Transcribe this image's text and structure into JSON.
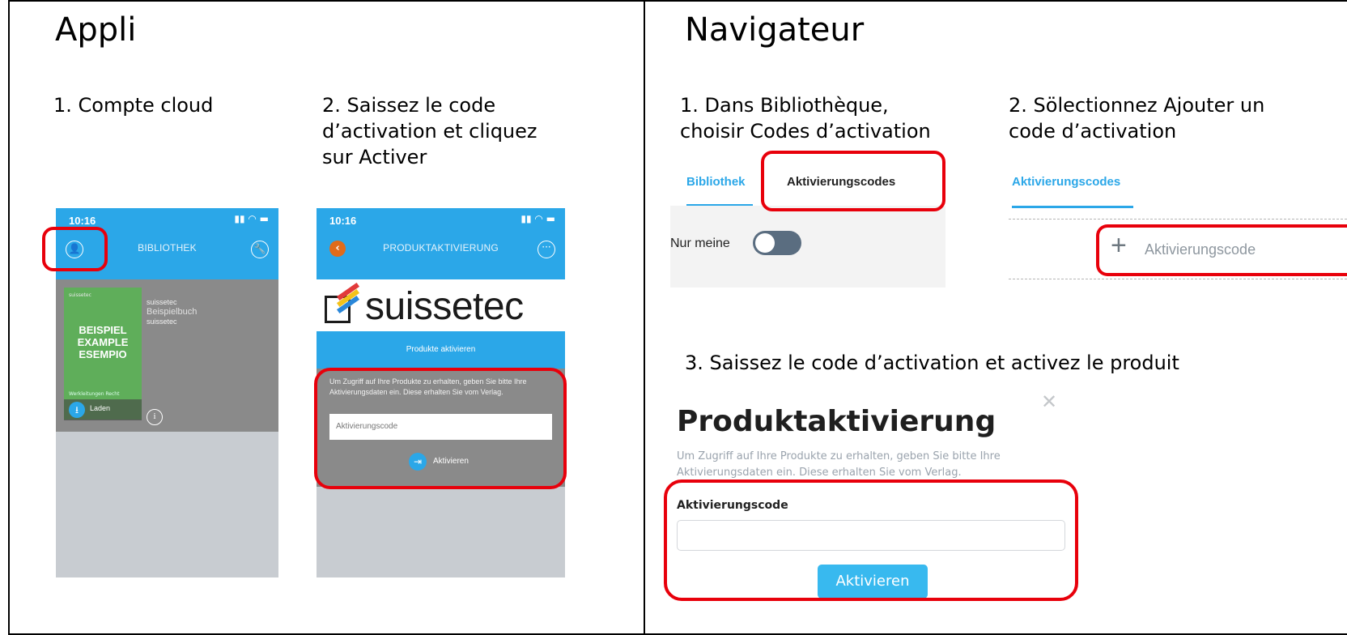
{
  "left": {
    "heading": "Appli",
    "step1": "1. Compte cloud",
    "step2_line1": "2. Saissez le code",
    "step2_line2": "d’activation et cliquez",
    "step2_line3": "sur Activer"
  },
  "phone1": {
    "time": "10:16",
    "title": "BIBLIOTHEK",
    "book": {
      "cover_brand": "suissetec",
      "cover_title_1": "BEISPIEL",
      "cover_title_2": "EXAMPLE",
      "cover_title_3": "ESEMPIO",
      "cover_sub": "Werkleitungen Recht",
      "load_label": "Laden",
      "publisher": "suissetec",
      "name": "Beispielbuch",
      "author": "suissetec"
    }
  },
  "phone2": {
    "time": "10:16",
    "title": "PRODUKTAKTIVIERUNG",
    "logo": "suissetec",
    "band": "Produkte aktivieren",
    "instructions": "Um Zugriff auf Ihre Produkte zu erhalten, geben Sie bitte Ihre Aktivierungsdaten ein. Diese erhalten Sie vom Verlag.",
    "input_placeholder": "Aktivierungscode",
    "activate_label": "Aktivieren"
  },
  "right": {
    "heading": "Navigateur",
    "step1_line1": "1. Dans Bibliothèque,",
    "step1_line2": "choisir Codes d’activation",
    "step2_line1": "2. Sölectionnez Ajouter un",
    "step2_line2": "code d’activation",
    "step3": "3. Saissez le code d’activation et activez le produit"
  },
  "browser_tabs": {
    "tab1": "Bibliothek",
    "tab2": "Aktivierungscodes",
    "toggle_label": "Nur meine"
  },
  "browser_codes": {
    "tab": "Aktivierungscodes",
    "add_label": "Aktivierungscode"
  },
  "modal": {
    "title": "Produktaktivierung",
    "text": "Um Zugriff auf Ihre Produkte zu erhalten, geben Sie bitte Ihre Aktivierungsdaten ein. Diese erhalten Sie vom Verlag.",
    "field_label": "Aktivierungscode",
    "button": "Aktivieren",
    "close": "✕"
  },
  "colors": {
    "accent_blue": "#2ba7e8",
    "highlight_red": "#e8000b",
    "button_blue": "#38b9ef"
  }
}
